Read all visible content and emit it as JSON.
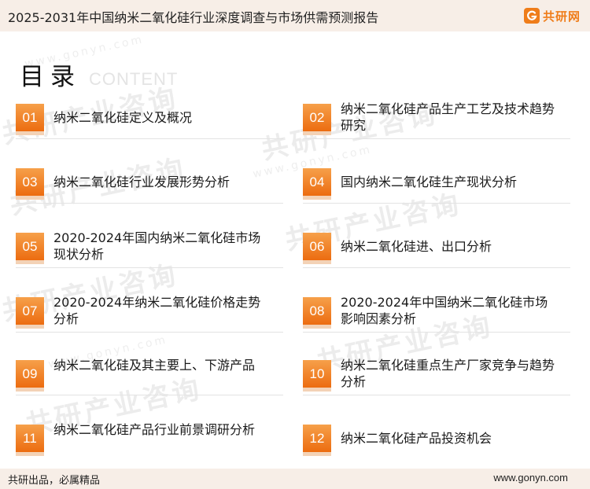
{
  "header": {
    "title": "2025-2031年中国纳米二氧化硅行业深度调查与市场供需预测报告",
    "brand": "共研网",
    "brand_icon": "gongyan-logo-icon",
    "accent": "#ef7d1a"
  },
  "heading": {
    "title": "目录",
    "subtitle": "CONTENT"
  },
  "watermark": {
    "text": "共研产业咨询",
    "url": "www.gonyn.com"
  },
  "toc": [
    {
      "number": "01",
      "title": "纳米二氧化硅定义及概况"
    },
    {
      "number": "02",
      "title": "纳米二氧化硅产品生产工艺及技术趋势研究"
    },
    {
      "number": "03",
      "title": "纳米二氧化硅行业发展形势分析"
    },
    {
      "number": "04",
      "title": "国内纳米二氧化硅生产现状分析"
    },
    {
      "number": "05",
      "title": "2020-2024年国内纳米二氧化硅市场现状分析"
    },
    {
      "number": "06",
      "title": "纳米二氧化硅进、出口分析"
    },
    {
      "number": "07",
      "title": "2020-2024年纳米二氧化硅价格走势分析"
    },
    {
      "number": "08",
      "title": "2020-2024年中国纳米二氧化硅市场影响因素分析"
    },
    {
      "number": "09",
      "title": "纳米二氧化硅及其主要上、下游产品"
    },
    {
      "number": "10",
      "title": "纳米二氧化硅重点生产厂家竞争与趋势分析"
    },
    {
      "number": "11",
      "title": "纳米二氧化硅产品行业前景调研分析"
    },
    {
      "number": "12",
      "title": "纳米二氧化硅产品投资机会"
    }
  ],
  "footer": {
    "slogan": "共研出品，必属精品",
    "url": "www.gonyn.com"
  }
}
